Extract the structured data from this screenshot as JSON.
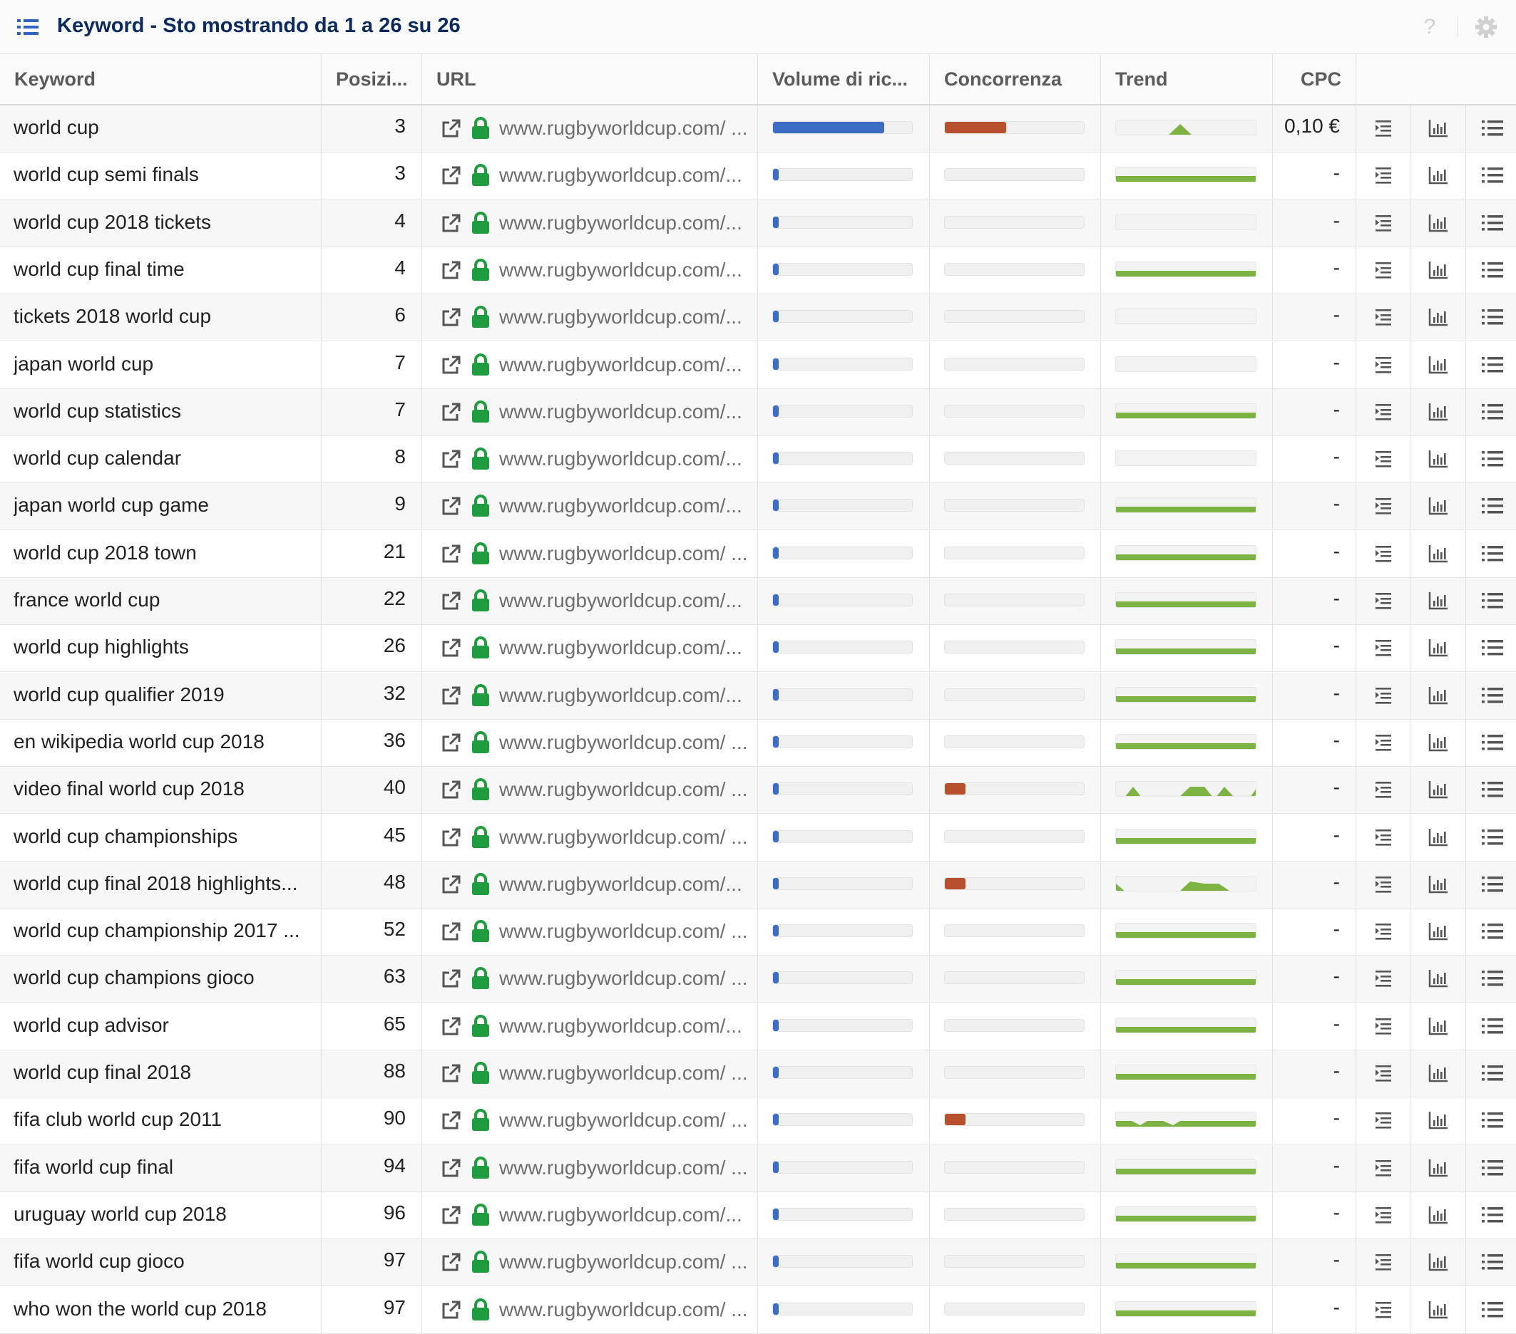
{
  "header": {
    "title": "Keyword - Sto mostrando da 1 a 26 su 26",
    "help_label": "?"
  },
  "columns": {
    "keyword": "Keyword",
    "position": "Posizi...",
    "url": "URL",
    "volume": "Volume di ric...",
    "competition": "Concorrenza",
    "trend": "Trend",
    "cpc": "CPC"
  },
  "colors": {
    "volume_bar": "#3d6cc4",
    "competition_bar": "#b84f2e",
    "trend_fill": "#7cb342",
    "lock": "#1e9c3e",
    "title": "#0c2a5c",
    "header_icon": "#2f63c2"
  },
  "icons": {
    "header": "list-icon",
    "help": "help-icon",
    "settings": "gear-icon",
    "external": "external-link-icon",
    "secure": "lock-icon",
    "row_actions": [
      "indent-list-icon",
      "bar-chart-icon",
      "list-icon"
    ]
  },
  "rows": [
    {
      "keyword": "world cup",
      "position": "3",
      "url": "www.rugbyworldcup.com/ ...",
      "volume": 0.8,
      "competition": 0.44,
      "cpc": "0,10 €",
      "trend": "spike"
    },
    {
      "keyword": "world cup semi finals",
      "position": "3",
      "url": "www.rugbyworldcup.com/...",
      "volume": 0.04,
      "competition": 0,
      "cpc": "-",
      "trend": "flat"
    },
    {
      "keyword": "world cup 2018 tickets",
      "position": "4",
      "url": "www.rugbyworldcup.com/...",
      "volume": 0.04,
      "competition": 0,
      "cpc": "-",
      "trend": "none"
    },
    {
      "keyword": "world cup final time",
      "position": "4",
      "url": "www.rugbyworldcup.com/...",
      "volume": 0.04,
      "competition": 0,
      "cpc": "-",
      "trend": "flat"
    },
    {
      "keyword": "tickets 2018 world cup",
      "position": "6",
      "url": "www.rugbyworldcup.com/...",
      "volume": 0.04,
      "competition": 0,
      "cpc": "-",
      "trend": "none"
    },
    {
      "keyword": "japan world cup",
      "position": "7",
      "url": "www.rugbyworldcup.com/...",
      "volume": 0.04,
      "competition": 0,
      "cpc": "-",
      "trend": "none"
    },
    {
      "keyword": "world cup statistics",
      "position": "7",
      "url": "www.rugbyworldcup.com/...",
      "volume": 0.04,
      "competition": 0,
      "cpc": "-",
      "trend": "flat"
    },
    {
      "keyword": "world cup calendar",
      "position": "8",
      "url": "www.rugbyworldcup.com/...",
      "volume": 0.04,
      "competition": 0,
      "cpc": "-",
      "trend": "none"
    },
    {
      "keyword": "japan world cup game",
      "position": "9",
      "url": "www.rugbyworldcup.com/...",
      "volume": 0.04,
      "competition": 0,
      "cpc": "-",
      "trend": "flat"
    },
    {
      "keyword": "world cup 2018 town",
      "position": "21",
      "url": "www.rugbyworldcup.com/ ...",
      "volume": 0.04,
      "competition": 0,
      "cpc": "-",
      "trend": "flat"
    },
    {
      "keyword": "france world cup",
      "position": "22",
      "url": "www.rugbyworldcup.com/...",
      "volume": 0.04,
      "competition": 0,
      "cpc": "-",
      "trend": "flat"
    },
    {
      "keyword": "world cup highlights",
      "position": "26",
      "url": "www.rugbyworldcup.com/...",
      "volume": 0.04,
      "competition": 0,
      "cpc": "-",
      "trend": "flat"
    },
    {
      "keyword": "world cup qualifier 2019",
      "position": "32",
      "url": "www.rugbyworldcup.com/...",
      "volume": 0.04,
      "competition": 0,
      "cpc": "-",
      "trend": "flat"
    },
    {
      "keyword": "en wikipedia world cup 2018",
      "position": "36",
      "url": "www.rugbyworldcup.com/ ...",
      "volume": 0.04,
      "competition": 0,
      "cpc": "-",
      "trend": "flat"
    },
    {
      "keyword": "video final world cup 2018",
      "position": "40",
      "url": "www.rugbyworldcup.com/ ...",
      "volume": 0.04,
      "competition": 0.15,
      "cpc": "-",
      "trend": "multi"
    },
    {
      "keyword": "world cup championships",
      "position": "45",
      "url": "www.rugbyworldcup.com/ ...",
      "volume": 0.04,
      "competition": 0,
      "cpc": "-",
      "trend": "flat"
    },
    {
      "keyword": "world cup final 2018 highlights...",
      "position": "48",
      "url": "www.rugbyworldcup.com/...",
      "volume": 0.04,
      "competition": 0.15,
      "cpc": "-",
      "trend": "partial"
    },
    {
      "keyword": "world cup championship 2017 ...",
      "position": "52",
      "url": "www.rugbyworldcup.com/ ...",
      "volume": 0.04,
      "competition": 0,
      "cpc": "-",
      "trend": "flat"
    },
    {
      "keyword": "world cup champions gioco",
      "position": "63",
      "url": "www.rugbyworldcup.com/ ...",
      "volume": 0.04,
      "competition": 0,
      "cpc": "-",
      "trend": "flat"
    },
    {
      "keyword": "world cup advisor",
      "position": "65",
      "url": "www.rugbyworldcup.com/...",
      "volume": 0.04,
      "competition": 0,
      "cpc": "-",
      "trend": "flat"
    },
    {
      "keyword": "world cup final 2018",
      "position": "88",
      "url": "www.rugbyworldcup.com/ ...",
      "volume": 0.04,
      "competition": 0,
      "cpc": "-",
      "trend": "flat"
    },
    {
      "keyword": "fifa club world cup 2011",
      "position": "90",
      "url": "www.rugbyworldcup.com/ ...",
      "volume": 0.04,
      "competition": 0.15,
      "cpc": "-",
      "trend": "dips"
    },
    {
      "keyword": "fifa world cup final",
      "position": "94",
      "url": "www.rugbyworldcup.com/ ...",
      "volume": 0.04,
      "competition": 0,
      "cpc": "-",
      "trend": "flat"
    },
    {
      "keyword": "uruguay world cup 2018",
      "position": "96",
      "url": "www.rugbyworldcup.com/...",
      "volume": 0.04,
      "competition": 0,
      "cpc": "-",
      "trend": "flat"
    },
    {
      "keyword": "fifa world cup gioco",
      "position": "97",
      "url": "www.rugbyworldcup.com/ ...",
      "volume": 0.04,
      "competition": 0,
      "cpc": "-",
      "trend": "flat"
    },
    {
      "keyword": "who won the world cup 2018",
      "position": "97",
      "url": "www.rugbyworldcup.com/ ...",
      "volume": 0.04,
      "competition": 0,
      "cpc": "-",
      "trend": "flat"
    }
  ]
}
